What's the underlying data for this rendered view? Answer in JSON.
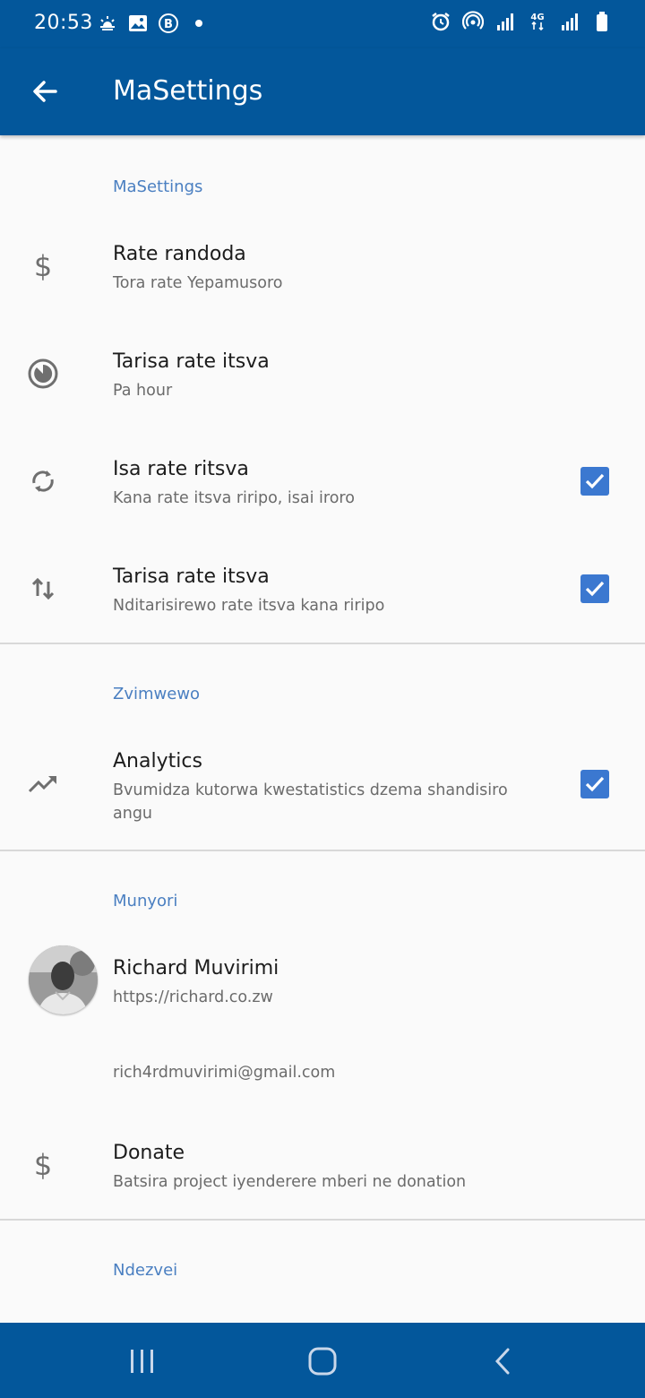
{
  "status_bar": {
    "time": "20:53",
    "left_icons": [
      "weather-icon",
      "image-icon",
      "b-badge-icon",
      "dot-icon"
    ],
    "right_icons": [
      "alarm-icon",
      "hotspot-icon",
      "signal-icon",
      "4g-icon",
      "signal-icon",
      "battery-icon"
    ],
    "network": "4G"
  },
  "app_bar": {
    "title": "MaSettings",
    "back_icon": "arrow-left-icon"
  },
  "sections": {
    "main": {
      "header": "MaSettings",
      "items": [
        {
          "title": "Rate randoda",
          "summary": "Tora rate Yepamusoro",
          "icon": "dollar-icon"
        },
        {
          "title": "Tarisa rate itsva",
          "summary": "Pa hour",
          "icon": "timer-icon"
        },
        {
          "title": "Isa rate ritsva",
          "summary": "Kana rate itsva riripo, isai iroro",
          "icon": "sync-icon",
          "checked": true
        },
        {
          "title": "Tarisa rate itsva",
          "summary": "Nditarisirewo rate itsva kana riripo",
          "icon": "swap-vertical-icon",
          "checked": true
        }
      ]
    },
    "other": {
      "header": "Zvimwewo",
      "items": [
        {
          "title": "Analytics",
          "summary": "Bvumidza kutorwa kwestatistics dzema shandisiro angu",
          "icon": "trending-up-icon",
          "checked": true
        }
      ]
    },
    "author": {
      "header": "Munyori",
      "name": "Richard Muvirimi",
      "website": "https://richard.co.zw",
      "email": "rich4rdmuvirimi@gmail.com",
      "donate_title": "Donate",
      "donate_summary": "Batsira project iyenderere mberi ne donation"
    },
    "about": {
      "header": "Ndezvei"
    }
  },
  "nav_bar": {
    "buttons": [
      "recents-icon",
      "home-icon",
      "back-icon"
    ]
  },
  "colors": {
    "primary": "#03579b",
    "accent": "#3b78d0",
    "category": "#4a7fc1"
  }
}
